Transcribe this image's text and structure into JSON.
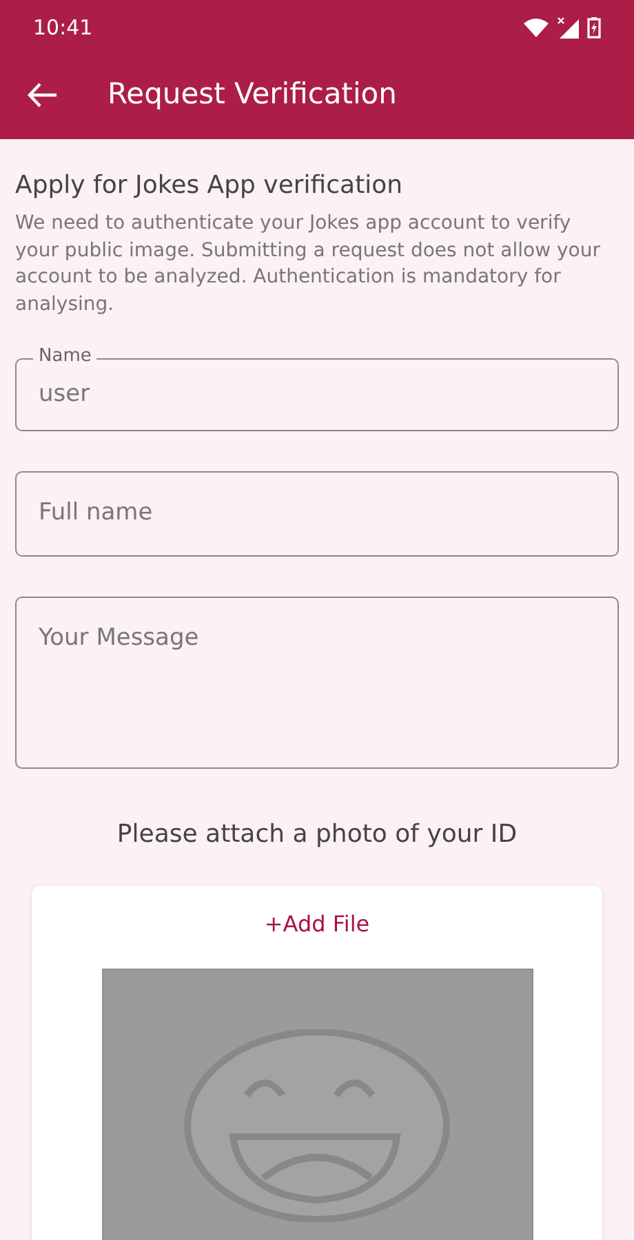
{
  "status_bar": {
    "time": "10:41"
  },
  "app_bar": {
    "title": "Request Verification"
  },
  "heading": "Apply for Jokes App verification",
  "description": "We need to authenticate your Jokes app account to verify your public image. Submitting a request does not allow your account to be analyzed. Authentication is mandatory for analysing.",
  "fields": [
    {
      "kind": "single",
      "label": "Name",
      "value": "user"
    },
    {
      "kind": "single",
      "placeholder": "Full name"
    },
    {
      "kind": "multi",
      "placeholder": "Your Message"
    }
  ],
  "attach_prompt": "Please attach a photo of your ID",
  "upload": {
    "button": "+Add File"
  }
}
